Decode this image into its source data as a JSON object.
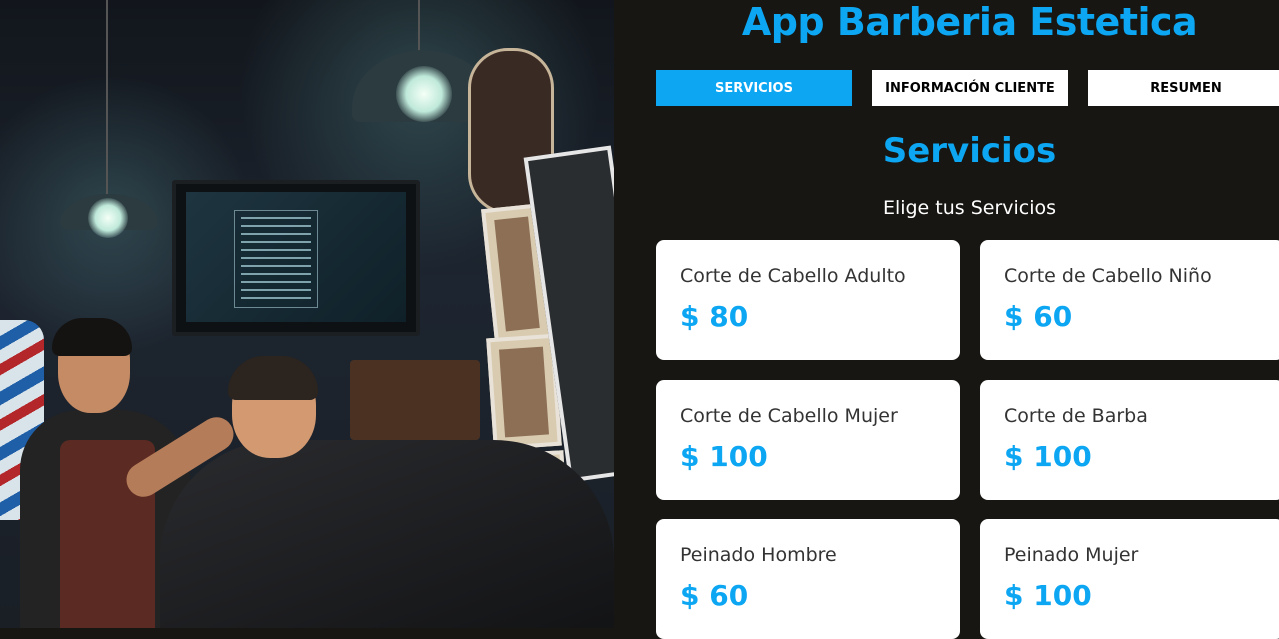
{
  "app": {
    "title": "App Barberia Estetica"
  },
  "tabs": [
    {
      "label": "SERVICIOS",
      "active": true
    },
    {
      "label": "INFORMACIÓN CLIENTE",
      "active": false
    },
    {
      "label": "RESUMEN",
      "active": false
    }
  ],
  "section": {
    "title": "Servicios",
    "subtitle": "Elige tus Servicios"
  },
  "services": [
    {
      "name": "Corte de Cabello Adulto",
      "price": "$ 80"
    },
    {
      "name": "Corte de Cabello Niño",
      "price": "$ 60"
    },
    {
      "name": "Corte de Cabello Mujer",
      "price": "$ 100"
    },
    {
      "name": "Corte de Barba",
      "price": "$ 100"
    },
    {
      "name": "Peinado Hombre",
      "price": "$ 60"
    },
    {
      "name": "Peinado Mujer",
      "price": "$ 100"
    }
  ],
  "colors": {
    "accent": "#0da6f3",
    "background": "#171612",
    "card": "#ffffff"
  }
}
